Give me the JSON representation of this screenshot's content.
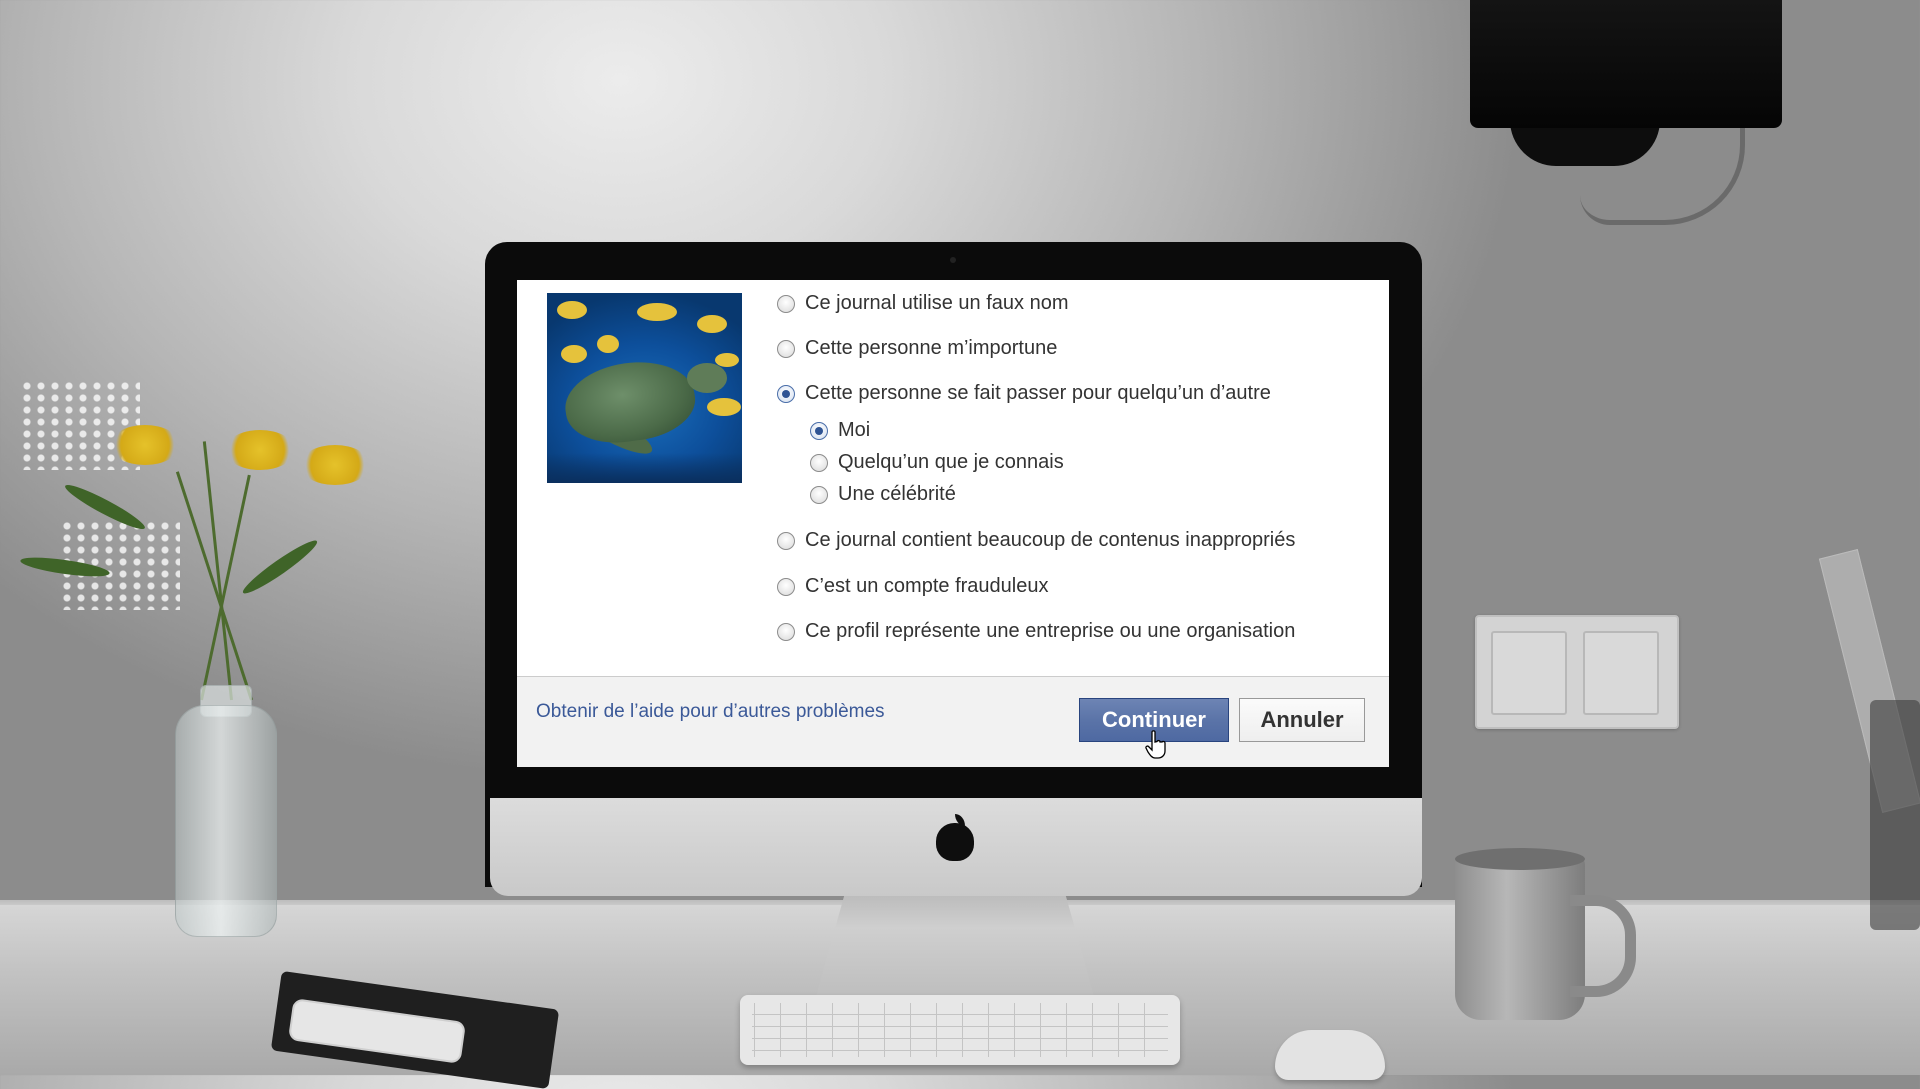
{
  "dialog": {
    "options": [
      {
        "label": "Ce journal utilise un faux nom",
        "checked": false
      },
      {
        "label": "Cette personne m’importune",
        "checked": false
      },
      {
        "label": "Cette personne se fait passer pour quelqu’un d’autre",
        "checked": true
      },
      {
        "label": "Ce journal contient beaucoup de contenus inappropriés",
        "checked": false
      },
      {
        "label": "C’est un compte frauduleux",
        "checked": false
      },
      {
        "label": "Ce profil représente une entreprise ou une organisation",
        "checked": false
      }
    ],
    "sub_options": [
      {
        "label": "Moi",
        "checked": true
      },
      {
        "label": "Quelqu’un que je connais",
        "checked": false
      },
      {
        "label": "Une célébrité",
        "checked": false
      }
    ],
    "footer": {
      "help_link": "Obtenir de l’aide pour d’autres problèmes",
      "continue_label": "Continuer",
      "cancel_label": "Annuler"
    },
    "profile_image": "sea-turtle-photo"
  },
  "colors": {
    "link": "#3b5998",
    "primary_button": "#5b74a8",
    "radio_checked": "#2f5494"
  }
}
